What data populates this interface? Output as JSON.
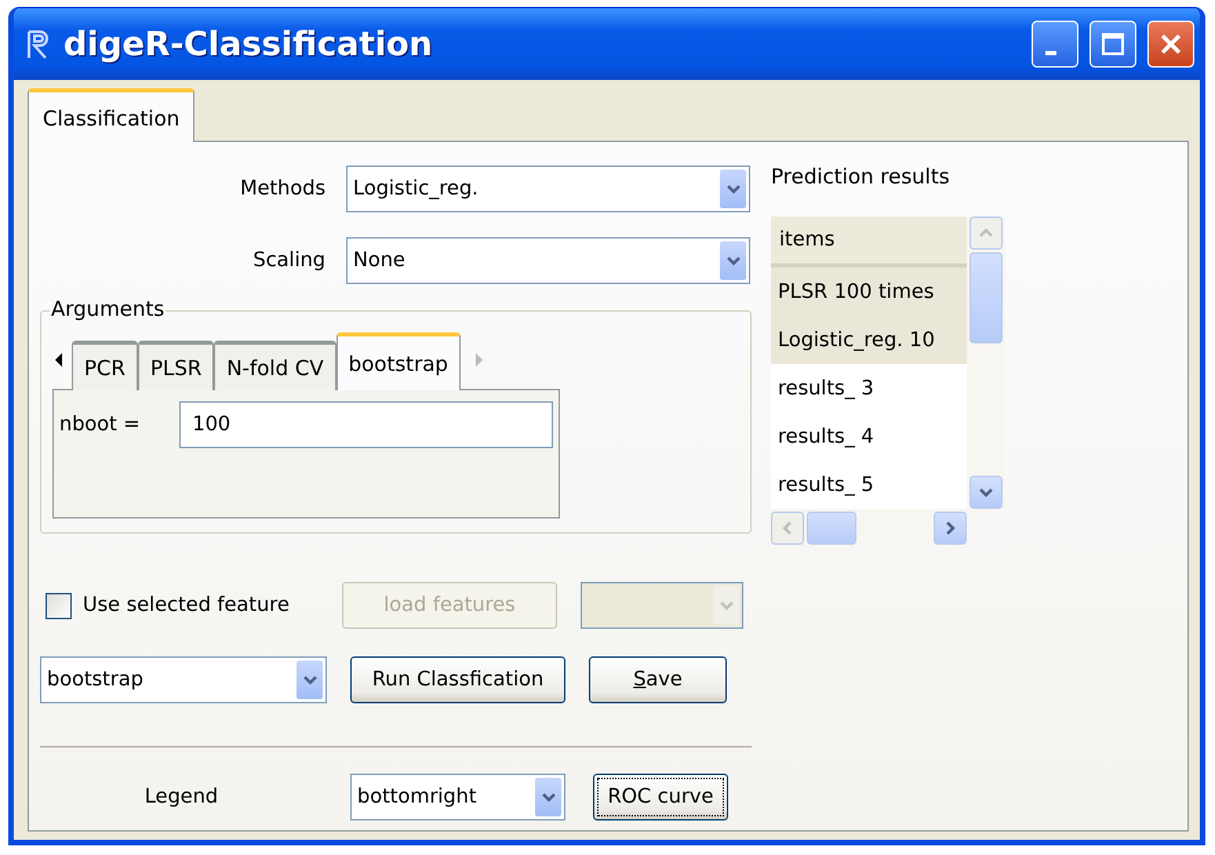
{
  "window": {
    "title": "digeR-Classification"
  },
  "tabs": [
    {
      "label": "Classification",
      "selected": true
    }
  ],
  "methods": {
    "label": "Methods",
    "value": "Logistic_reg."
  },
  "scaling": {
    "label": "Scaling",
    "value": "None"
  },
  "arguments": {
    "title": "Arguments",
    "tabs": [
      {
        "label": "PCR",
        "selected": false
      },
      {
        "label": "PLSR",
        "selected": false
      },
      {
        "label": "N-fold CV",
        "selected": false
      },
      {
        "label": "bootstrap",
        "selected": true
      }
    ],
    "fields": [
      {
        "label": "nboot =",
        "value": "100"
      }
    ]
  },
  "feature": {
    "label": "Use selected feature",
    "checked": false
  },
  "load_button": {
    "label": "load features",
    "disabled": true
  },
  "feature_combo": {
    "disabled": true
  },
  "validation_combo": {
    "value": "bootstrap"
  },
  "buttons": [
    {
      "label": "Run Classfication",
      "underline_first": false
    },
    {
      "label": "Save",
      "underline_first": true
    }
  ],
  "legend": {
    "label": "Legend",
    "value": "bottomright"
  },
  "roc_button": {
    "label": "ROC curve",
    "focused": true
  },
  "results": {
    "title": "Prediction results",
    "header": "items",
    "rows": [
      {
        "label": "PLSR 100 times",
        "selected": true
      },
      {
        "label": "Logistic_reg. 10",
        "selected": true
      },
      {
        "label": "results_ 3",
        "selected": false
      },
      {
        "label": "results_ 4",
        "selected": false
      },
      {
        "label": "results_ 5",
        "selected": false
      }
    ]
  }
}
